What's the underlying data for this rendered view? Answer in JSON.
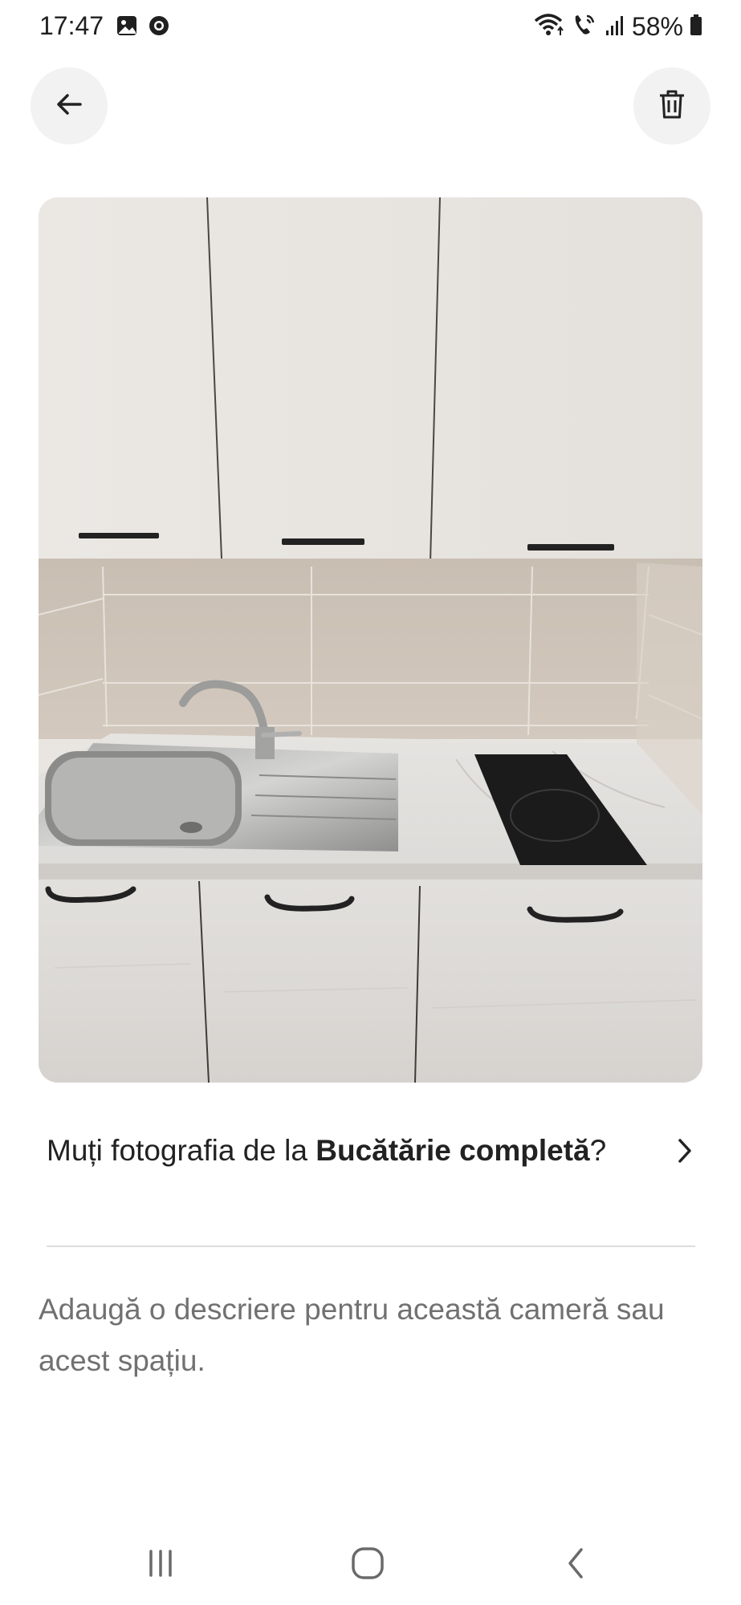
{
  "status_bar": {
    "time": "17:47",
    "battery": "58%",
    "left_icons": [
      "gallery-icon",
      "chrome-icon"
    ],
    "right_icons": [
      "wifi-icon",
      "wifi-calling-icon",
      "signal-icon",
      "battery-icon"
    ]
  },
  "header": {
    "back_icon": "arrow-left-icon",
    "delete_icon": "trash-icon"
  },
  "photo": {
    "subject": "kitchen-photo"
  },
  "move_prompt": {
    "prefix": "Muți fotografia de la ",
    "room": "Bucătărie completă",
    "suffix": "?",
    "icon": "chevron-right-icon"
  },
  "description": {
    "placeholder": "Adaugă o descriere pentru această cameră sau acest spațiu."
  },
  "nav_bar": {
    "icons": [
      "recents-icon",
      "home-icon",
      "back-icon"
    ]
  },
  "colors": {
    "text_primary": "#222222",
    "text_secondary": "#717171",
    "button_bg": "#f2f2f2",
    "divider": "#dddddd"
  }
}
